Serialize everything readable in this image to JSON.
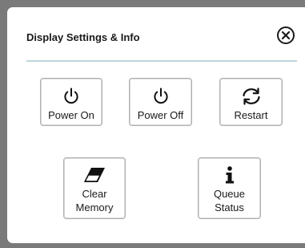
{
  "dialog": {
    "title": "Display Settings & Info",
    "close_icon": "close-circle-icon"
  },
  "actions": {
    "power_on": {
      "label": "Power On",
      "icon": "power-icon"
    },
    "power_off": {
      "label": "Power Off",
      "icon": "power-icon"
    },
    "restart": {
      "label": "Restart",
      "icon": "refresh-icon"
    },
    "clear_memory": {
      "label_line1": "Clear",
      "label_line2": "Memory",
      "icon": "eraser-icon"
    },
    "queue_status": {
      "label_line1": "Queue",
      "label_line2": "Status",
      "icon": "info-icon"
    }
  },
  "colors": {
    "divider": "#bcd6da",
    "backdrop": "#7a7a7a"
  }
}
